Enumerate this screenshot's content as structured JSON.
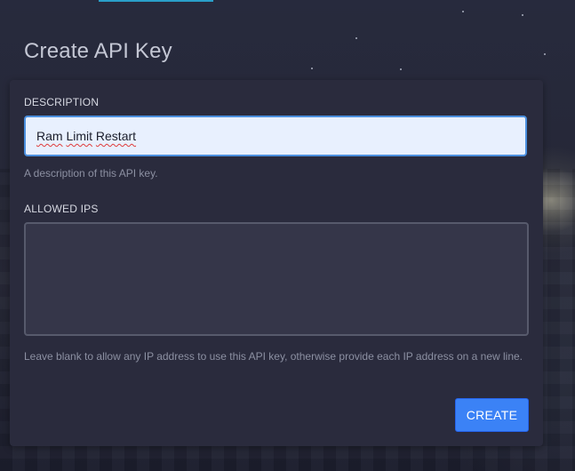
{
  "page": {
    "title": "Create API Key"
  },
  "form": {
    "description": {
      "label": "DESCRIPTION",
      "value": "Ram Limit Restart",
      "value_words": [
        "Ram",
        "Limit",
        "Restart"
      ],
      "help": "A description of this API key."
    },
    "allowed_ips": {
      "label": "ALLOWED IPS",
      "value": "",
      "help": "Leave blank to allow any IP address to use this API key, otherwise provide each IP address on a new line."
    },
    "submit_label": "CREATE"
  },
  "colors": {
    "accent": "#3b82f6",
    "card_bg": "#2a2b3d",
    "input_focus_bg": "#e8f0fe",
    "input_focus_border": "#4b8fde",
    "tab_indicator": "#2a9fc9"
  }
}
